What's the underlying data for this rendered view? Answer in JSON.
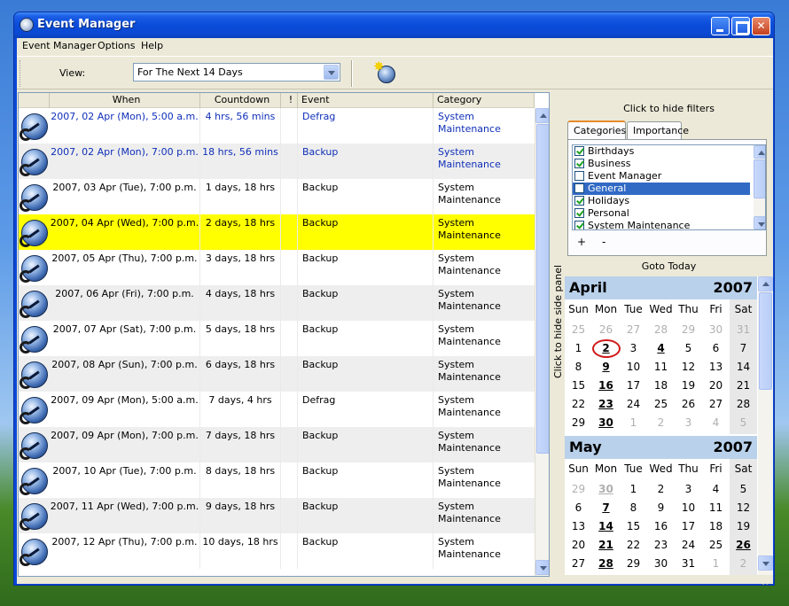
{
  "window": {
    "title": "Event Manager"
  },
  "menu": [
    "Event Manager",
    "Options",
    "Help"
  ],
  "toolbar": {
    "view_label": "View:",
    "view_value": "For The Next 14 Days"
  },
  "columns": {
    "when": "When",
    "countdown": "Countdown",
    "flag": "!",
    "event": "Event",
    "category": "Category"
  },
  "events": [
    {
      "when": "2007, 02 Apr (Mon), 5:00 a.m.",
      "countdown": "4 hrs, 56 mins",
      "event": "Defrag",
      "category": "System Maintenance",
      "style": "blue"
    },
    {
      "when": "2007, 02 Apr (Mon), 7:00 p.m.",
      "countdown": "18 hrs, 56 mins",
      "event": "Backup",
      "category": "System Maintenance",
      "style": "blue"
    },
    {
      "when": "2007, 03 Apr (Tue), 7:00 p.m.",
      "countdown": "1 days, 18 hrs",
      "event": "Backup",
      "category": "System Maintenance",
      "style": ""
    },
    {
      "when": "2007, 04 Apr (Wed), 7:00 p.m.",
      "countdown": "2 days, 18 hrs",
      "event": "Backup",
      "category": "System Maintenance",
      "style": "highlight"
    },
    {
      "when": "2007, 05 Apr (Thu), 7:00 p.m.",
      "countdown": "3 days, 18 hrs",
      "event": "Backup",
      "category": "System Maintenance",
      "style": ""
    },
    {
      "when": "2007, 06 Apr (Fri), 7:00 p.m.",
      "countdown": "4 days, 18 hrs",
      "event": "Backup",
      "category": "System Maintenance",
      "style": ""
    },
    {
      "when": "2007, 07 Apr (Sat), 7:00 p.m.",
      "countdown": "5 days, 18 hrs",
      "event": "Backup",
      "category": "System Maintenance",
      "style": ""
    },
    {
      "when": "2007, 08 Apr (Sun), 7:00 p.m.",
      "countdown": "6 days, 18 hrs",
      "event": "Backup",
      "category": "System Maintenance",
      "style": ""
    },
    {
      "when": "2007, 09 Apr (Mon), 5:00 a.m.",
      "countdown": "7 days, 4 hrs",
      "event": "Defrag",
      "category": "System Maintenance",
      "style": ""
    },
    {
      "when": "2007, 09 Apr (Mon), 7:00 p.m.",
      "countdown": "7 days, 18 hrs",
      "event": "Backup",
      "category": "System Maintenance",
      "style": ""
    },
    {
      "when": "2007, 10 Apr (Tue), 7:00 p.m.",
      "countdown": "8 days, 18 hrs",
      "event": "Backup",
      "category": "System Maintenance",
      "style": ""
    },
    {
      "when": "2007, 11 Apr (Wed), 7:00 p.m.",
      "countdown": "9 days, 18 hrs",
      "event": "Backup",
      "category": "System Maintenance",
      "style": ""
    },
    {
      "when": "2007, 12 Apr (Thu), 7:00 p.m.",
      "countdown": "10 days, 18 hrs",
      "event": "Backup",
      "category": "System Maintenance",
      "style": ""
    }
  ],
  "side": {
    "hide_filters": "Click to hide filters",
    "hide_side_panel": "Click to hide side panel",
    "tabs": [
      "Categories",
      "Importance"
    ],
    "categories": [
      {
        "label": "Birthdays",
        "checked": true,
        "selected": false
      },
      {
        "label": "Business",
        "checked": true,
        "selected": false
      },
      {
        "label": "Event Manager",
        "checked": false,
        "selected": false
      },
      {
        "label": "General",
        "checked": false,
        "selected": true
      },
      {
        "label": "Holidays",
        "checked": true,
        "selected": false
      },
      {
        "label": "Personal",
        "checked": true,
        "selected": false
      },
      {
        "label": "System Maintenance",
        "checked": true,
        "selected": false
      }
    ],
    "plus": "+",
    "minus": "-",
    "goto_today": "Goto Today"
  },
  "calendar": {
    "dow": [
      "Sun",
      "Mon",
      "Tue",
      "Wed",
      "Thu",
      "Fri",
      "Sat"
    ],
    "months": [
      {
        "name": "April",
        "year": "2007",
        "weeks": [
          [
            {
              "d": "25",
              "o": 1
            },
            {
              "d": "26",
              "o": 1
            },
            {
              "d": "27",
              "o": 1
            },
            {
              "d": "28",
              "o": 1
            },
            {
              "d": "29",
              "o": 1
            },
            {
              "d": "30",
              "o": 1
            },
            {
              "d": "31",
              "o": 1
            }
          ],
          [
            {
              "d": "1"
            },
            {
              "d": "2",
              "b": 1,
              "t": 1
            },
            {
              "d": "3"
            },
            {
              "d": "4",
              "b": 1
            },
            {
              "d": "5"
            },
            {
              "d": "6"
            },
            {
              "d": "7"
            }
          ],
          [
            {
              "d": "8"
            },
            {
              "d": "9",
              "b": 1
            },
            {
              "d": "10"
            },
            {
              "d": "11"
            },
            {
              "d": "12"
            },
            {
              "d": "13"
            },
            {
              "d": "14"
            }
          ],
          [
            {
              "d": "15"
            },
            {
              "d": "16",
              "b": 1
            },
            {
              "d": "17"
            },
            {
              "d": "18"
            },
            {
              "d": "19"
            },
            {
              "d": "20"
            },
            {
              "d": "21"
            }
          ],
          [
            {
              "d": "22"
            },
            {
              "d": "23",
              "b": 1
            },
            {
              "d": "24"
            },
            {
              "d": "25"
            },
            {
              "d": "26"
            },
            {
              "d": "27"
            },
            {
              "d": "28"
            }
          ],
          [
            {
              "d": "29"
            },
            {
              "d": "30",
              "b": 1
            },
            {
              "d": "1",
              "o": 1
            },
            {
              "d": "2",
              "o": 1
            },
            {
              "d": "3",
              "o": 1
            },
            {
              "d": "4",
              "o": 1
            },
            {
              "d": "5",
              "o": 1
            }
          ]
        ]
      },
      {
        "name": "May",
        "year": "2007",
        "weeks": [
          [
            {
              "d": "29",
              "o": 1
            },
            {
              "d": "30",
              "o": 1,
              "b": 1
            },
            {
              "d": "1"
            },
            {
              "d": "2"
            },
            {
              "d": "3"
            },
            {
              "d": "4"
            },
            {
              "d": "5"
            }
          ],
          [
            {
              "d": "6"
            },
            {
              "d": "7",
              "b": 1
            },
            {
              "d": "8"
            },
            {
              "d": "9"
            },
            {
              "d": "10"
            },
            {
              "d": "11"
            },
            {
              "d": "12"
            }
          ],
          [
            {
              "d": "13"
            },
            {
              "d": "14",
              "b": 1
            },
            {
              "d": "15"
            },
            {
              "d": "16"
            },
            {
              "d": "17"
            },
            {
              "d": "18"
            },
            {
              "d": "19"
            }
          ],
          [
            {
              "d": "20"
            },
            {
              "d": "21",
              "b": 1
            },
            {
              "d": "22"
            },
            {
              "d": "23"
            },
            {
              "d": "24"
            },
            {
              "d": "25"
            },
            {
              "d": "26",
              "b": 1
            }
          ],
          [
            {
              "d": "27"
            },
            {
              "d": "28",
              "b": 1
            },
            {
              "d": "29"
            },
            {
              "d": "30"
            },
            {
              "d": "31"
            },
            {
              "d": "1",
              "o": 1
            },
            {
              "d": "2",
              "o": 1
            }
          ]
        ]
      }
    ]
  }
}
